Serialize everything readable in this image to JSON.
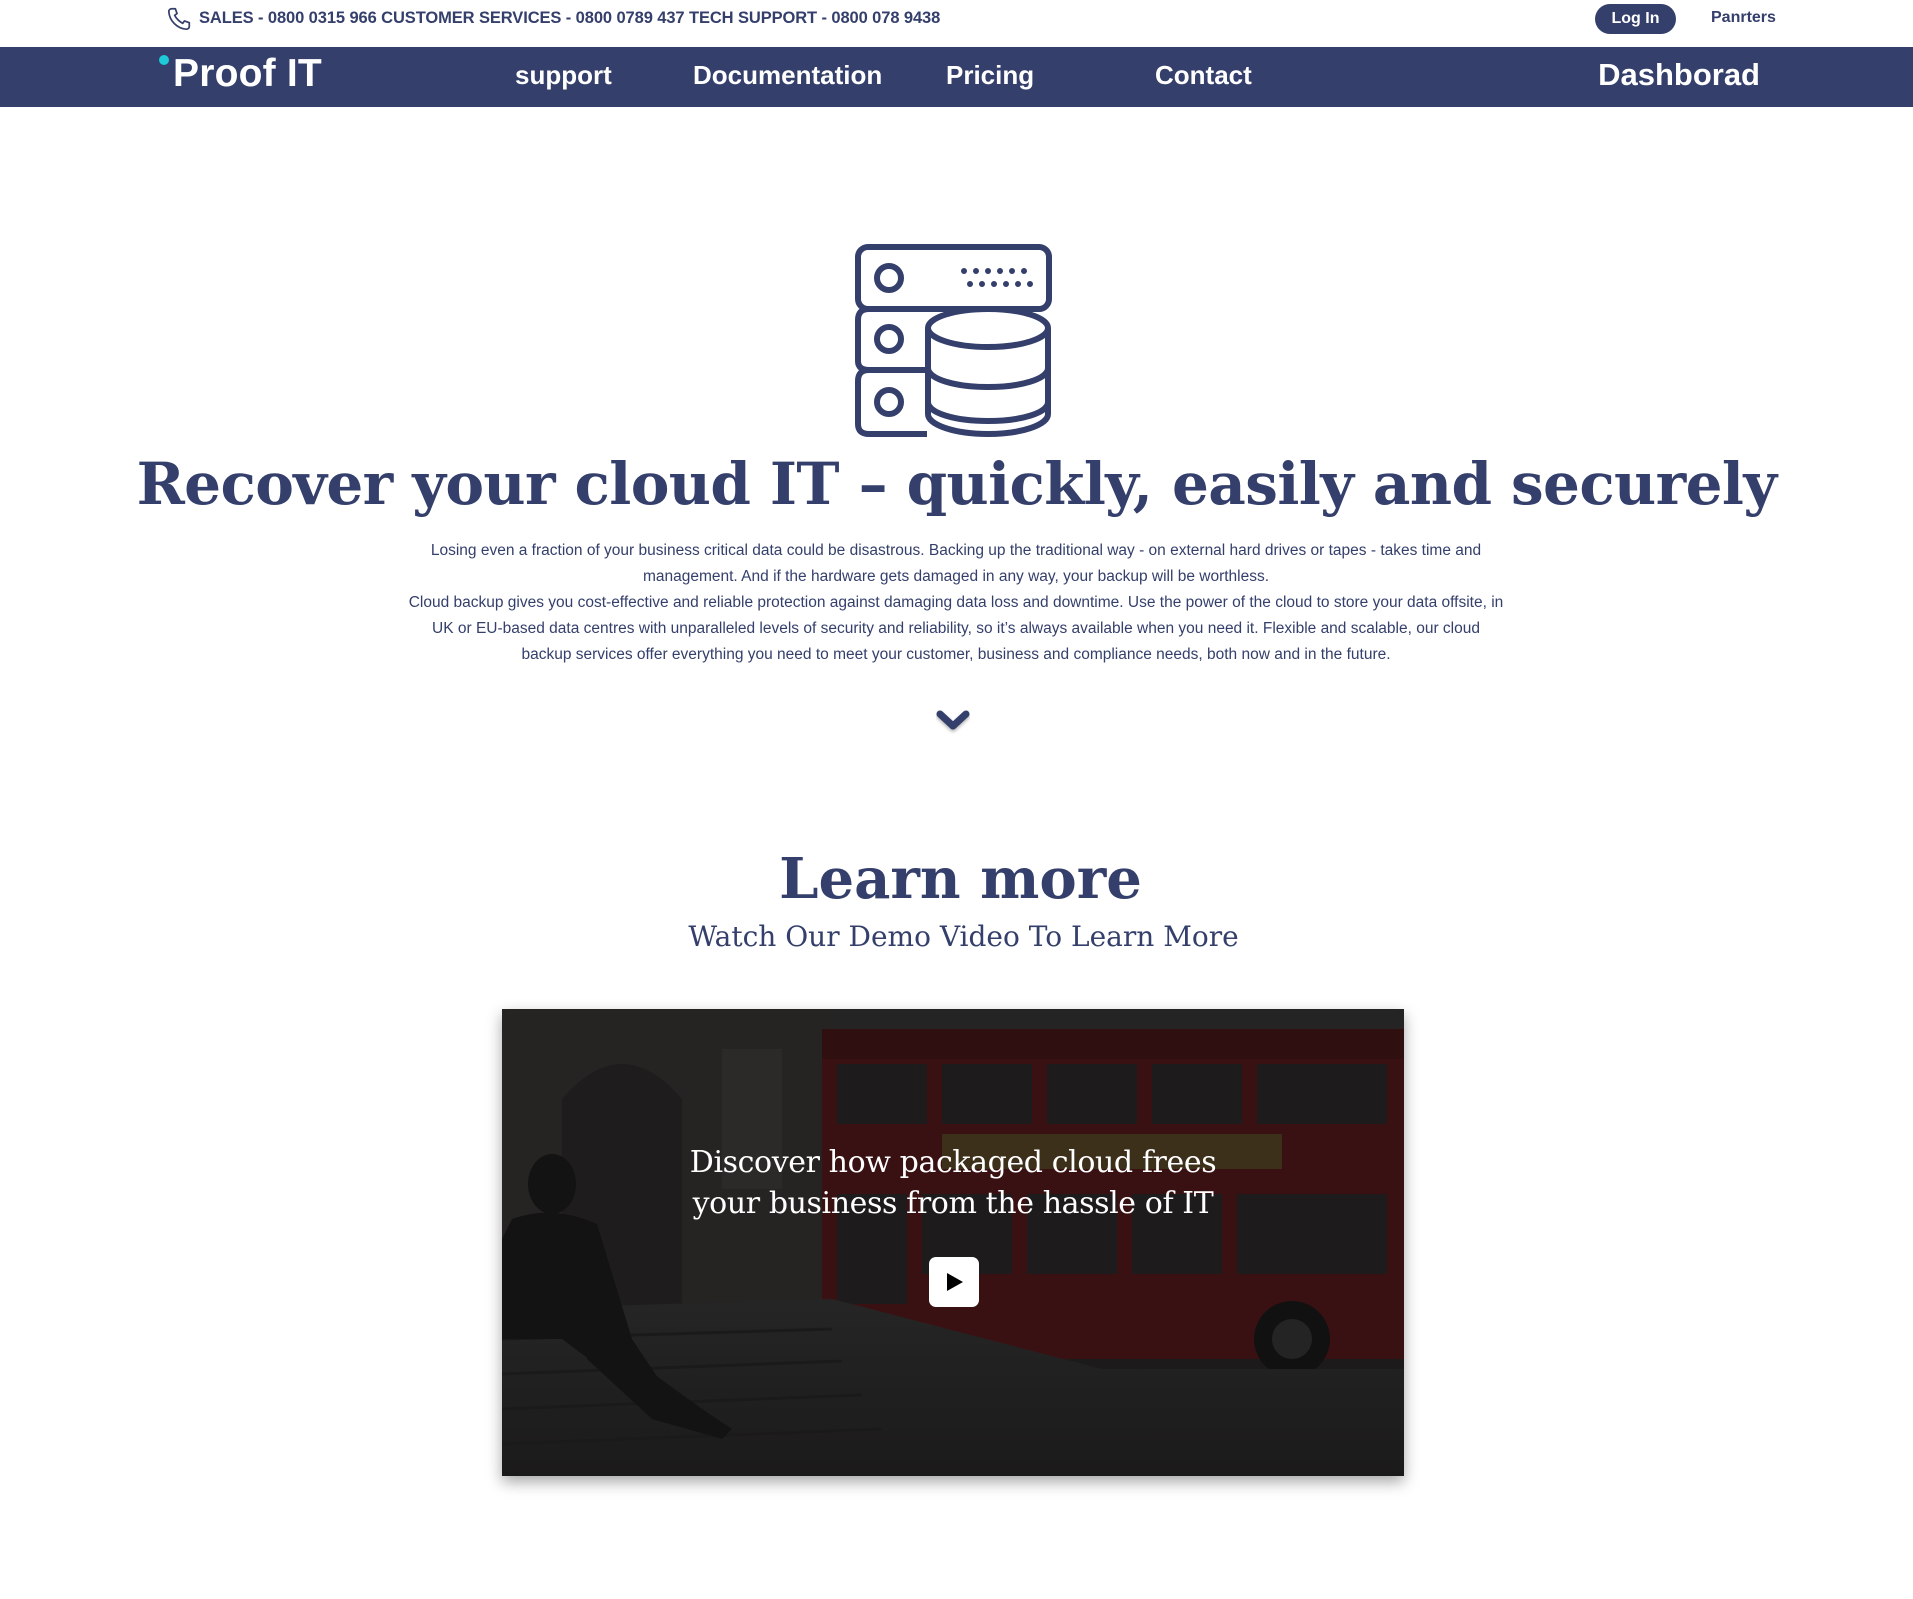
{
  "colors": {
    "brand_navy": "#343f6b",
    "accent_teal": "#1ec9d8",
    "white": "#ffffff"
  },
  "topbar": {
    "phone_icon": "phone-icon",
    "contact_line": "SALES - 0800 0315 966 CUSTOMER SERVICES - 0800 0789 437 TECH SUPPORT - 0800 078 9438",
    "login_label": "Log In",
    "partners_label": "Panrters"
  },
  "nav": {
    "logo": "Proof IT",
    "items": [
      {
        "label": "support"
      },
      {
        "label": "Documentation"
      },
      {
        "label": "Pricing"
      },
      {
        "label": "Contact"
      }
    ],
    "dashboard_label": "Dashborad"
  },
  "hero": {
    "icon": "server-database-icon",
    "title": "Recover your  cloud IT – quickly, easily and securely",
    "paragraphs": [
      "Losing even a fraction of your business critical data could be disastrous. Backing up the traditional way - on external hard drives or tapes - takes time and management. And if the hardware gets damaged in any way, your backup will be worthless.",
      "Cloud backup gives you cost-effective and reliable protection against damaging data loss and downtime. Use the power of the cloud to store your data offsite, in UK or EU-based data centres with unparalleled levels of security and reliability, so it’s always available when you need it. Flexible and scalable, our cloud backup services offer everything you need to meet your customer, business and compliance needs, both now and in the future."
    ],
    "scroll_icon": "chevron-down-icon"
  },
  "learn_more": {
    "title": "Learn more",
    "subtitle": "Watch Our Demo Video To Learn More"
  },
  "video": {
    "caption_line1": "Discover how packaged cloud frees",
    "caption_line2": "your business from the hassle of IT",
    "play_icon": "play-icon"
  }
}
